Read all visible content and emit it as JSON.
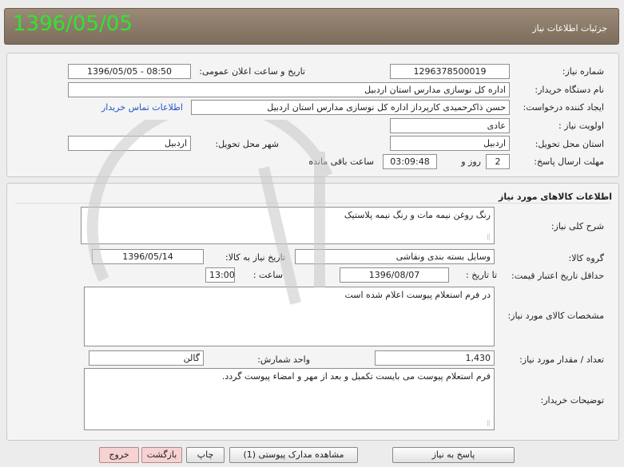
{
  "header": {
    "date": "1396/05/05",
    "title": "جزئیات اطلاعات نیاز"
  },
  "need": {
    "number_label": "شماره نیاز:",
    "number": "1296378500019",
    "announce_label": "تاریخ و ساعت اعلان عمومی:",
    "announce": "1396/05/05 - 08:50",
    "buyer_label": "نام دستگاه خریدار:",
    "buyer": "اداره کل نوسازی مدارس استان اردبیل",
    "creator_label": "ایجاد کننده درخواست:",
    "creator": "حسن ذاکرحمیدی کارپرداز اداره کل نوسازی مدارس استان اردبیل",
    "contact_link": "اطلاعات تماس خریدار",
    "priority_label": "اولویت نیاز :",
    "priority": "عادی",
    "province_label": "استان محل تحویل:",
    "province": "اردبیل",
    "city_label": "شهر محل تحویل:",
    "city": "اردبیل",
    "deadline_label": "مهلت ارسال پاسخ:",
    "deadline_days": "2",
    "days_label": "روز و",
    "deadline_time": "03:09:48",
    "remaining_label": "ساعت باقی مانده"
  },
  "goods": {
    "section_title": "اطلاعات کالاهای مورد نیاز",
    "desc_label": "شرح کلی نیاز:",
    "desc": "رنگ روغن نیمه مات و رنگ نیمه پلاستیک",
    "group_label": "گروه کالا:",
    "group": "وسایل بسته بندی  ونقاشی",
    "need_date_label": "تاریخ نیاز به کالا:",
    "need_date": "1396/05/14",
    "min_validity_label": "حداقل تاریخ اعتبار قیمت:",
    "until_label": "تا تاریخ :",
    "validity_date": "1396/08/07",
    "time_label": "ساعت :",
    "validity_time": "13:00",
    "specs_label": "مشخصات کالای مورد نیاز:",
    "specs": "در فرم استعلام پیوست اعلام شده است",
    "qty_label": "تعداد / مقدار مورد نیاز:",
    "qty": "1,430",
    "unit_label": "واحد شمارش:",
    "unit": "گالن",
    "notes_label": "توضیحات خریدار:",
    "notes": "فرم استعلام پیوست می بایست تکمیل و بعد از مهر و امضاء پیوست گردد."
  },
  "buttons": {
    "reply": "پاسخ به نیاز",
    "attachments": "مشاهده مدارک پیوستی (1)",
    "print": "چاپ",
    "back": "بازگشت",
    "exit": "خروج"
  },
  "colors": {
    "header_bg": "#8b7a68",
    "date_green": "#2fe52f",
    "link_blue": "#2455c9",
    "watermark": "#c8c8c8"
  }
}
